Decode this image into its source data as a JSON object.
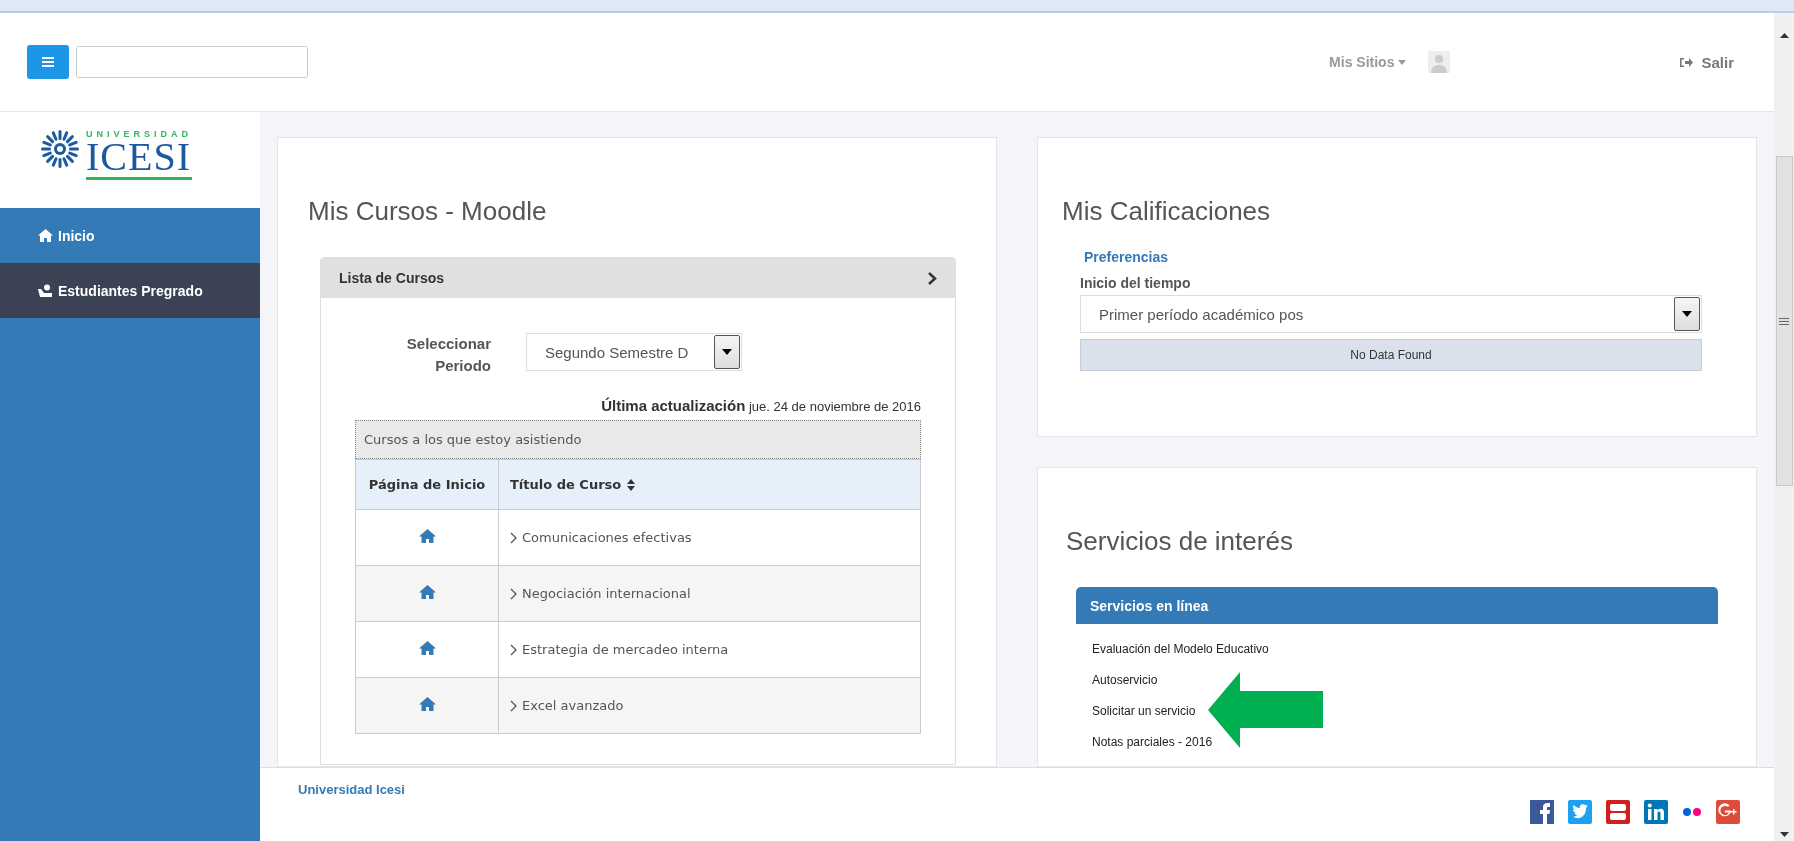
{
  "header": {
    "sites_menu": "Mis Sitios",
    "logout": "Salir"
  },
  "sidebar": {
    "logo_top": "UNIVERSIDAD",
    "logo_main": "ICESI",
    "items": [
      {
        "label": "Inicio",
        "kind": "home",
        "selected": false
      },
      {
        "label": "Estudiantes Pregrado",
        "kind": "student",
        "selected": true
      }
    ]
  },
  "courses_card": {
    "title": "Mis Cursos - Moodle",
    "panel_title": "Lista de Cursos",
    "period_label": "Seleccionar Periodo",
    "period_value": "Segundo Semestre D",
    "updated_label": "Última actualización",
    "updated_value": "jue. 24 de noviembre de 2016",
    "table_caption": "Cursos a los que estoy asistiendo",
    "columns": [
      "Página de Inicio",
      "Título de Curso"
    ],
    "rows": [
      {
        "title": "Comunicaciones efectivas"
      },
      {
        "title": "Negociación internacional"
      },
      {
        "title": "Estrategia de mercadeo interna"
      },
      {
        "title": "Excel avanzado"
      }
    ]
  },
  "grades_card": {
    "title": "Mis Calificaciones",
    "link": "Preferencias",
    "field_label": "Inicio del tiempo",
    "field_value": "Primer período académico pos",
    "message": "No Data Found"
  },
  "services_card": {
    "title": "Servicios de interés",
    "panel_title": "Servicios en línea",
    "items": [
      "Evaluación del Modelo Educativo",
      "Autoservicio",
      "Solicitar un servicio",
      "Notas parciales - 2016"
    ]
  },
  "footer": {
    "text": "Universidad Icesi",
    "social": [
      {
        "kind": "facebook"
      },
      {
        "kind": "twitter"
      },
      {
        "kind": "youtube"
      },
      {
        "kind": "linkedin"
      },
      {
        "kind": "flickr"
      },
      {
        "kind": "googleplus"
      }
    ]
  }
}
